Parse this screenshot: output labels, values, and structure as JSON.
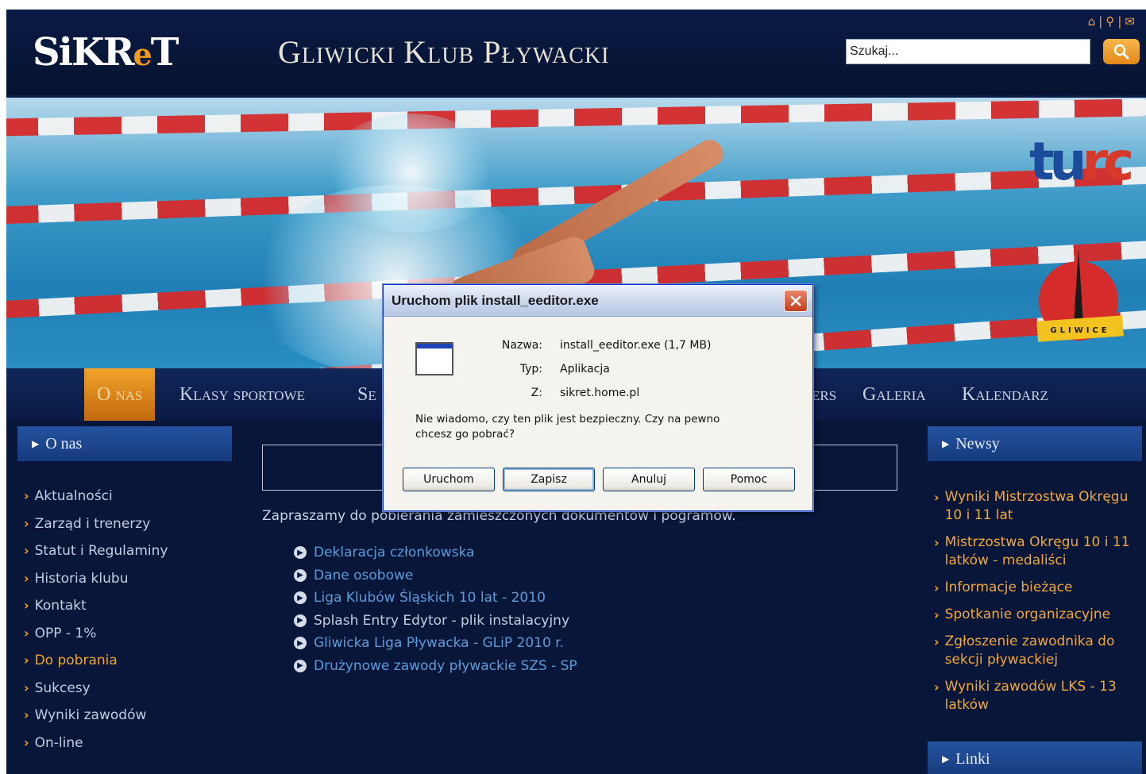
{
  "header": {
    "logo_text_1": "SiKR",
    "logo_text_e": "e",
    "logo_text_2": "T",
    "site_title": "Gliwicki Klub Pływacki",
    "search_placeholder": "Szukaj...",
    "top_icons": [
      "home-icon",
      "sitemap-icon",
      "mail-icon"
    ]
  },
  "banner": {
    "turc_logo_t": "tu",
    "turc_logo_c": "rc",
    "gliwice_logo_text": "GLIWICE"
  },
  "nav": {
    "items": [
      "O nas",
      "Klasy sportowe",
      "Se",
      "ers",
      "Galeria",
      "Kalendarz"
    ]
  },
  "left_sidebar": {
    "header": "O nas",
    "items": [
      "Aktualności",
      "Zarząd i trenerzy",
      "Statut i Regulaminy",
      "Historia klubu",
      "Kontakt",
      "OPP - 1%",
      "Do pobrania",
      "Sukcesy",
      "Wyniki zawodów",
      "On-line"
    ]
  },
  "main": {
    "intro": "Zapraszamy do pobierania zamieszczonych dokumentów i pogramów.",
    "documents": [
      "Deklaracja członkowska",
      "Dane osobowe",
      "Liga Klubów Śląskich 10 lat - 2010",
      "Splash Entry Edytor - plik instalacyjny",
      "Gliwicka Liga Pływacka - GLiP 2010 r.",
      "Drużynowe zawody pływackie SZS - SP"
    ]
  },
  "right_sidebar": {
    "header": "Newsy",
    "items": [
      "Wyniki Mistrzostwa Okręgu 10 i 11 lat",
      "Mistrzostwa Okręgu 10 i 11 latków - medaliści",
      "Informacje bieżące",
      "Spotkanie organizacyjne",
      "Zgłoszenie zawodnika do sekcji pływackiej",
      "Wyniki zawodów LKS - 13 latków"
    ],
    "links_header": "Linki"
  },
  "dialog": {
    "title": "Uruchom plik install_eeditor.exe",
    "name_label": "Nazwa:",
    "name_value": "install_eeditor.exe (1,7 MB)",
    "type_label": "Typ:",
    "type_value": "Aplikacja",
    "from_label": "Z:",
    "from_value": "sikret.home.pl",
    "question": "Nie wiadomo, czy ten plik jest bezpieczny. Czy na pewno chcesz go pobrać?",
    "buttons": [
      "Uruchom",
      "Zapisz",
      "Anuluj",
      "Pomoc"
    ]
  },
  "colors": {
    "page_bg": "#08163a",
    "accent_orange": "#f5a623",
    "link_blue": "#5b9bd9",
    "dialog_bg": "#ece9d8"
  }
}
